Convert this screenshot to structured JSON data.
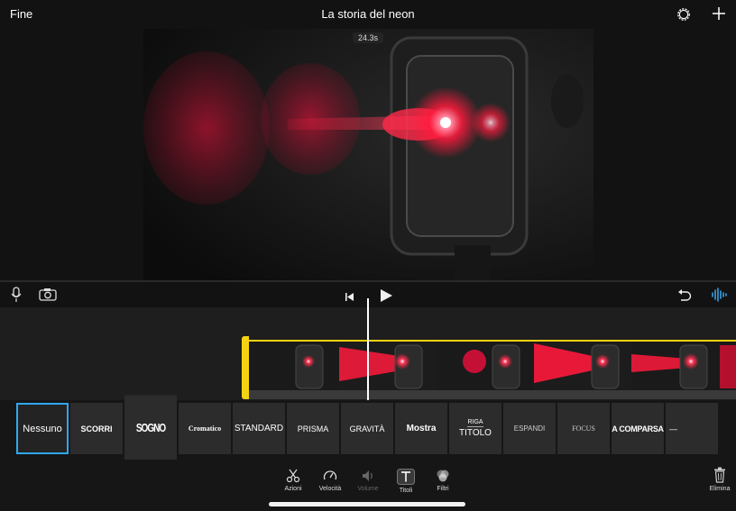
{
  "header": {
    "done_label": "Fine",
    "title": "La storia del neon"
  },
  "viewer": {
    "timecode": "24.3s"
  },
  "title_styles": [
    {
      "label": "Nessuno",
      "selected": true
    },
    {
      "label": "SCORRI"
    },
    {
      "label": "SOGNO"
    },
    {
      "label": "Cromatico"
    },
    {
      "label": "STANDARD"
    },
    {
      "label": "PRISMA"
    },
    {
      "label": "GRAVITÀ"
    },
    {
      "label": "Mostra"
    },
    {
      "label_top": "RIGA",
      "label": "TITOLO"
    },
    {
      "label": "ESPANDI"
    },
    {
      "label": "FOCUS"
    },
    {
      "label": "A COMPARSA"
    },
    {
      "label": "—"
    }
  ],
  "toolbar": {
    "actions": "Azioni",
    "speed": "Velocità",
    "volume": "Volume",
    "titles": "Titoli",
    "filters": "Filtri",
    "delete": "Elimina"
  },
  "colors": {
    "accent": "#2fa7f0",
    "clip_border": "#f5d313",
    "neon": "#ff1a3c"
  }
}
